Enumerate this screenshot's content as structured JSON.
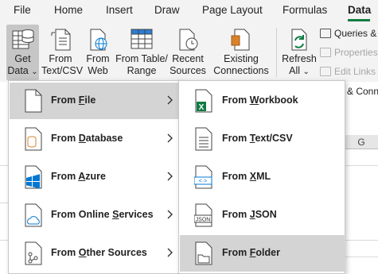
{
  "tabs": [
    {
      "label": "File"
    },
    {
      "label": "Home"
    },
    {
      "label": "Insert"
    },
    {
      "label": "Draw"
    },
    {
      "label": "Page Layout"
    },
    {
      "label": "Formulas"
    },
    {
      "label": "Data"
    }
  ],
  "ribbon": {
    "get_data": {
      "line1": "Get",
      "line2": "Data",
      "dropdown": "⌄"
    },
    "from_text_csv": {
      "line1": "From",
      "line2": "Text/CSV"
    },
    "from_web": {
      "line1": "From",
      "line2": "Web"
    },
    "from_table_range": {
      "line1": "From Table/",
      "line2": "Range"
    },
    "recent_sources": {
      "line1": "Recent",
      "line2": "Sources"
    },
    "existing_connections": {
      "line1": "Existing",
      "line2": "Connections"
    },
    "refresh_all": {
      "line1": "Refresh",
      "line2": "All",
      "dropdown": "⌄"
    },
    "queries_connections": "Queries &",
    "properties": "Properties",
    "edit_links": "Edit Links",
    "group_label_partial": "& Conn"
  },
  "grid": {
    "column_g": "G"
  },
  "menu_primary": [
    {
      "pre": "From ",
      "key": "F",
      "post": "ile",
      "icon": "file-icon"
    },
    {
      "pre": "From ",
      "key": "D",
      "post": "atabase",
      "icon": "database-icon"
    },
    {
      "pre": "From ",
      "key": "A",
      "post": "zure",
      "icon": "azure-icon"
    },
    {
      "pre": "From Online ",
      "key": "S",
      "post": "ervices",
      "icon": "online-services-icon"
    },
    {
      "pre": "From ",
      "key": "O",
      "post": "ther Sources",
      "icon": "other-sources-icon"
    }
  ],
  "menu_submenu": [
    {
      "pre": "From ",
      "key": "W",
      "post": "orkbook",
      "icon": "excel-workbook-icon"
    },
    {
      "pre": "From ",
      "key": "T",
      "post": "ext/CSV",
      "icon": "text-csv-icon"
    },
    {
      "pre": "From ",
      "key": "X",
      "post": "ML",
      "icon": "xml-icon"
    },
    {
      "pre": "From ",
      "key": "J",
      "post": "SON",
      "icon": "json-icon"
    },
    {
      "pre": "From ",
      "key": "F",
      "post": "older",
      "icon": "folder-icon"
    }
  ],
  "colors": {
    "accent_green": "#107c41",
    "highlight": "#d4d4d4",
    "ribbon_bg": "#f3f3f3",
    "azure_blue": "#0078d4",
    "db_orange": "#d9822b"
  }
}
